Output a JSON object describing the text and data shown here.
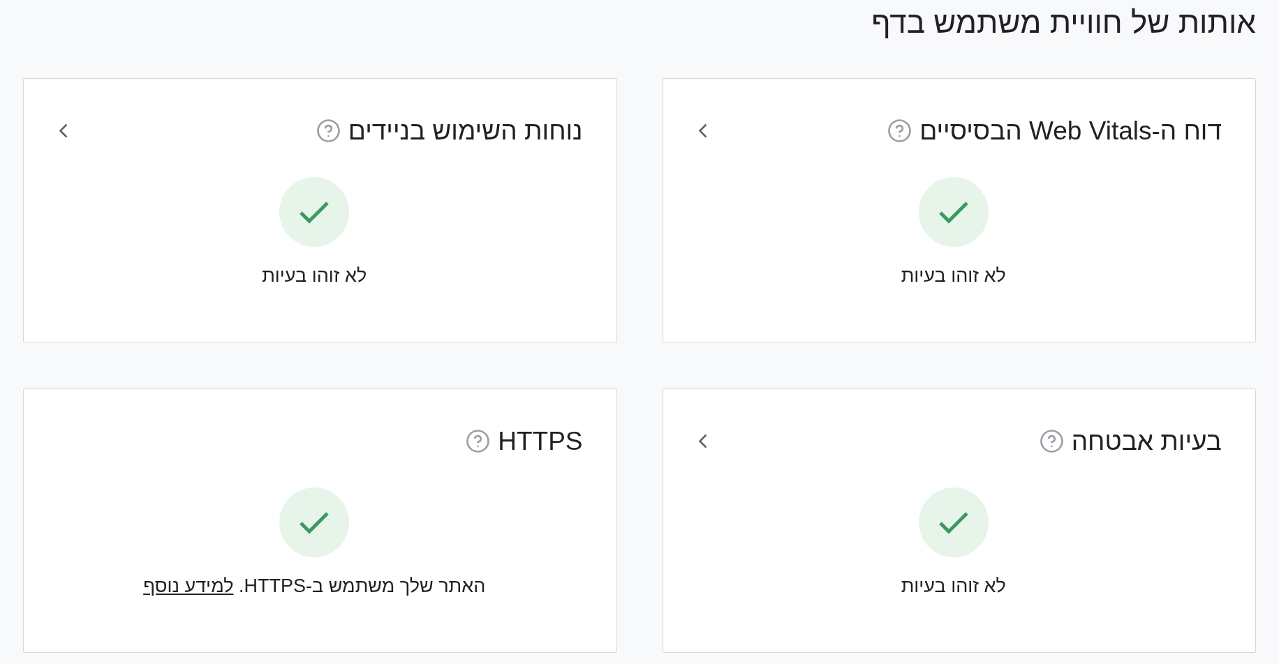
{
  "title": "אותות של חוויית משתמש בדף",
  "cards": [
    {
      "title": "דוח ה-Web Vitals הבסיסיים",
      "expandable": true,
      "status": "לא זוהו בעיות"
    },
    {
      "title": "נוחות השימוש בניידים",
      "expandable": true,
      "status": "לא זוהו בעיות"
    },
    {
      "title": "בעיות אבטחה",
      "expandable": true,
      "status": "לא זוהו בעיות"
    },
    {
      "title": "HTTPS",
      "expandable": false,
      "status": "האתר שלך משתמש ב-HTTPS.",
      "link": "למידע נוסף"
    }
  ]
}
